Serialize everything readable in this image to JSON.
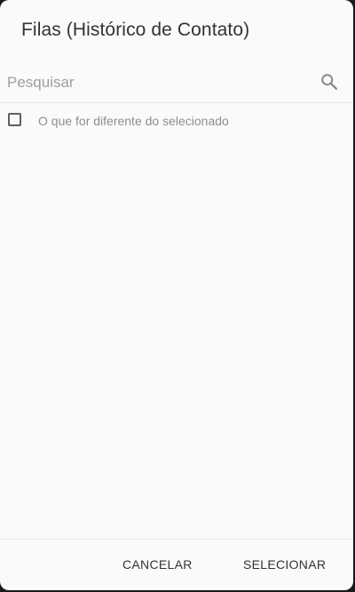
{
  "dialog": {
    "title": "Filas (Histórico de Contato)"
  },
  "search": {
    "placeholder": "Pesquisar",
    "value": "",
    "icon": "search-icon"
  },
  "options": [
    {
      "label": "O que for diferente do selecionado",
      "checked": false
    }
  ],
  "actions": {
    "cancel_label": "CANCELAR",
    "select_label": "SELECIONAR"
  }
}
